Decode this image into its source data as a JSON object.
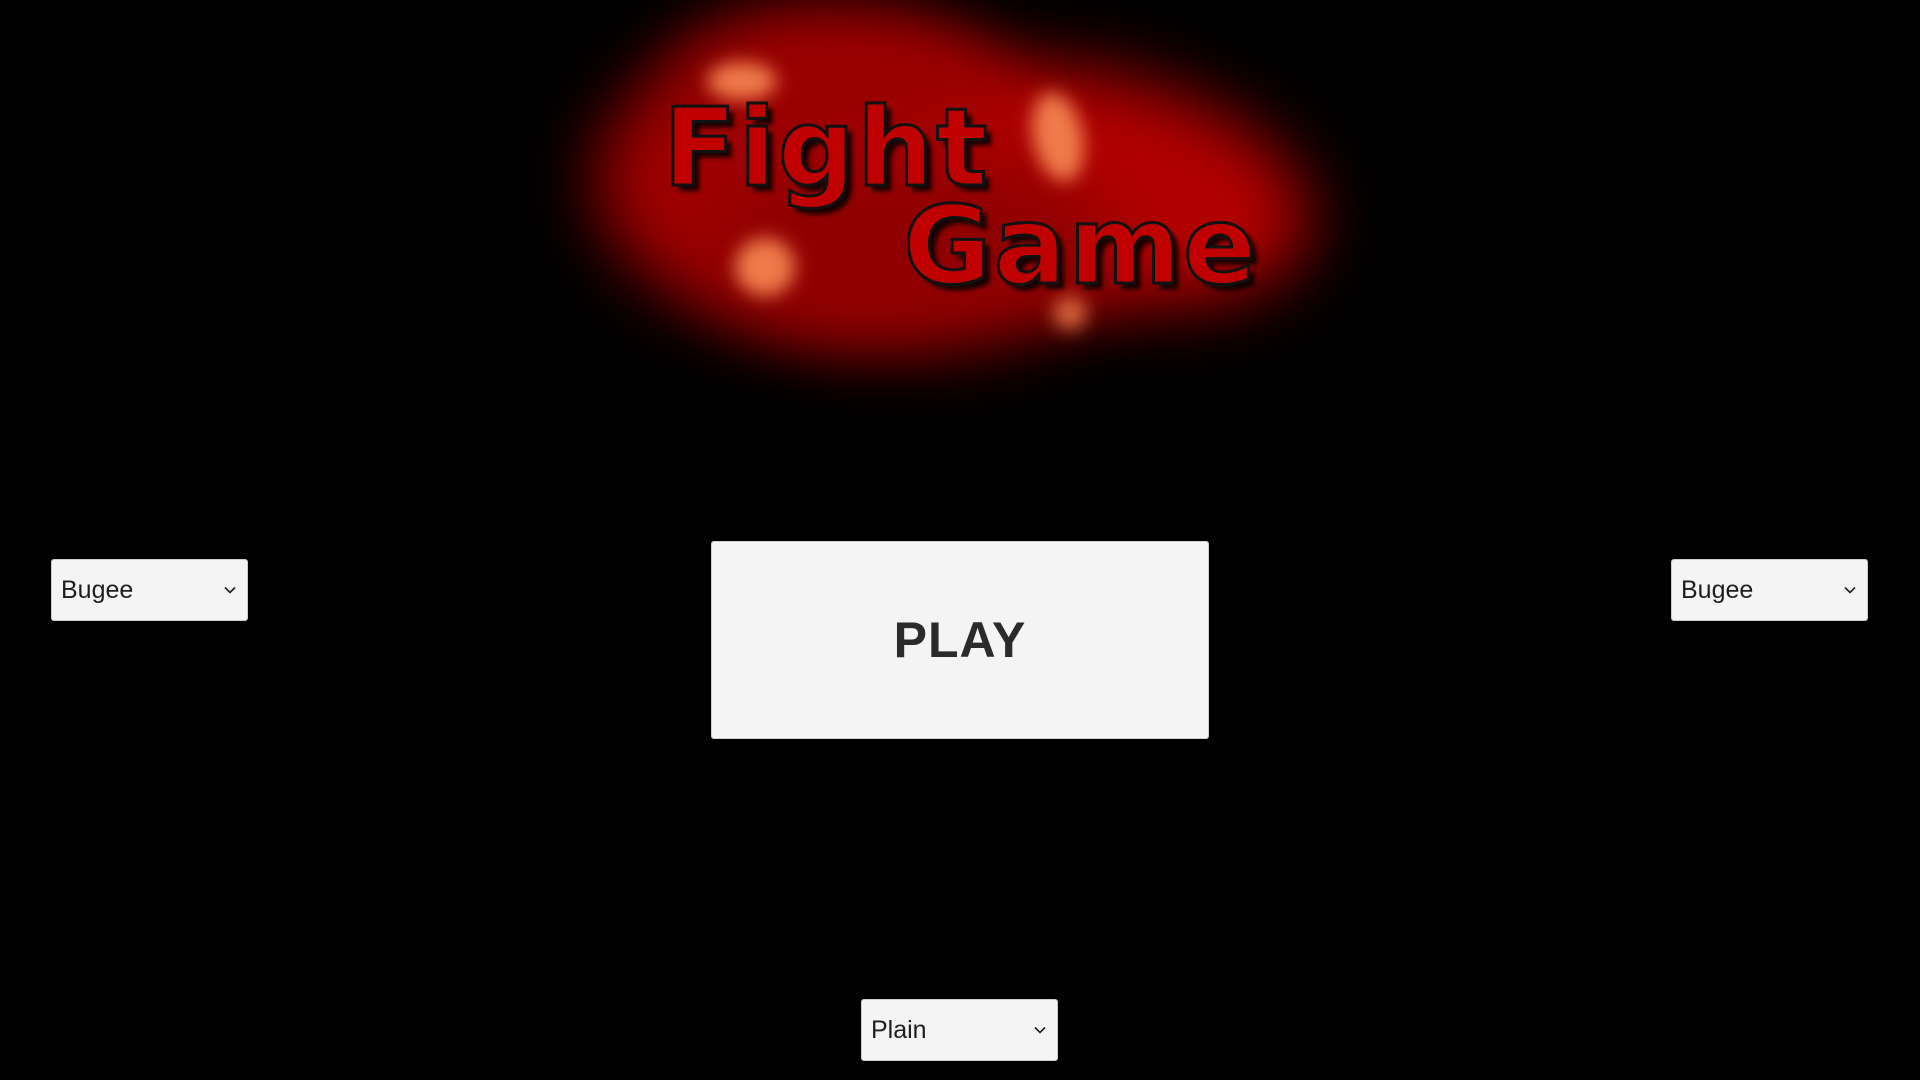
{
  "logo": {
    "line1": "Fight",
    "line2": "Game"
  },
  "player1_select": {
    "value": "Bugee",
    "icon": "chevron-down-icon"
  },
  "player2_select": {
    "value": "Bugee",
    "icon": "chevron-down-icon"
  },
  "play_button": {
    "label": "PLAY"
  },
  "stage_select": {
    "value": "Plain",
    "icon": "chevron-down-icon"
  },
  "colors": {
    "background": "#000000",
    "logo_red": "#c00000",
    "control_bg": "#f4f4f4",
    "control_text": "#1e1e1e"
  }
}
